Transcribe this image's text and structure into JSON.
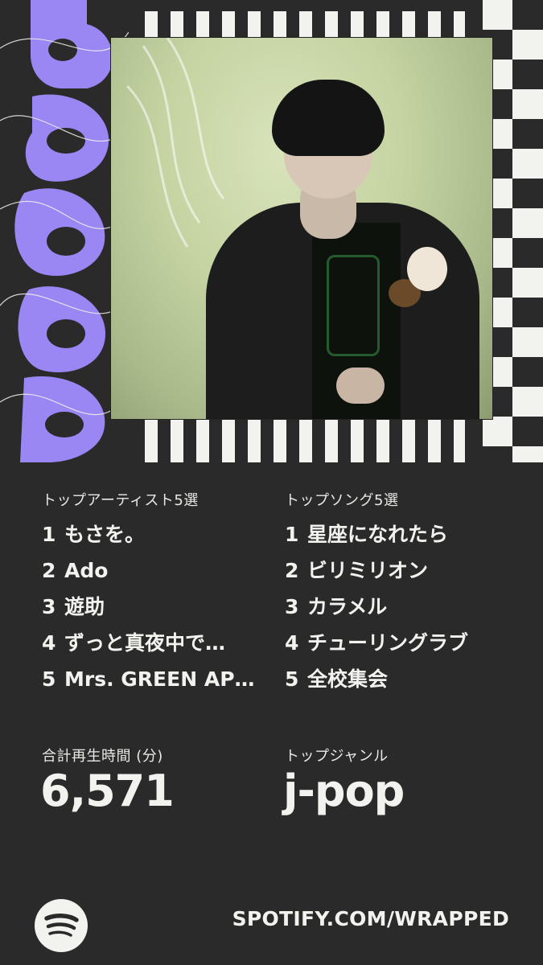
{
  "header": {
    "year_graphic_text": "2025",
    "accent_color": "#9a87f4",
    "checker_color": "#f2f2ee"
  },
  "photo": {
    "description_icon": "artist-photo"
  },
  "top_artists": {
    "label": "トップアーティスト5選",
    "items": [
      {
        "rank": "1",
        "name": "もさを。"
      },
      {
        "rank": "2",
        "name": "Ado"
      },
      {
        "rank": "3",
        "name": "遊助"
      },
      {
        "rank": "4",
        "name": "ずっと真夜中で…"
      },
      {
        "rank": "5",
        "name": "Mrs. GREEN AP…"
      }
    ]
  },
  "top_songs": {
    "label": "トップソング5選",
    "items": [
      {
        "rank": "1",
        "name": "星座になれたら"
      },
      {
        "rank": "2",
        "name": "ビリミリオン"
      },
      {
        "rank": "3",
        "name": "カラメル"
      },
      {
        "rank": "4",
        "name": "チューリングラブ"
      },
      {
        "rank": "5",
        "name": "全校集会"
      }
    ]
  },
  "minutes": {
    "label": "合計再生時間 (分)",
    "value": "6,571"
  },
  "genre": {
    "label": "トップジャンル",
    "value": "j-pop"
  },
  "footer": {
    "url": "SPOTIFY.COM/WRAPPED",
    "logo_icon": "spotify-icon"
  }
}
